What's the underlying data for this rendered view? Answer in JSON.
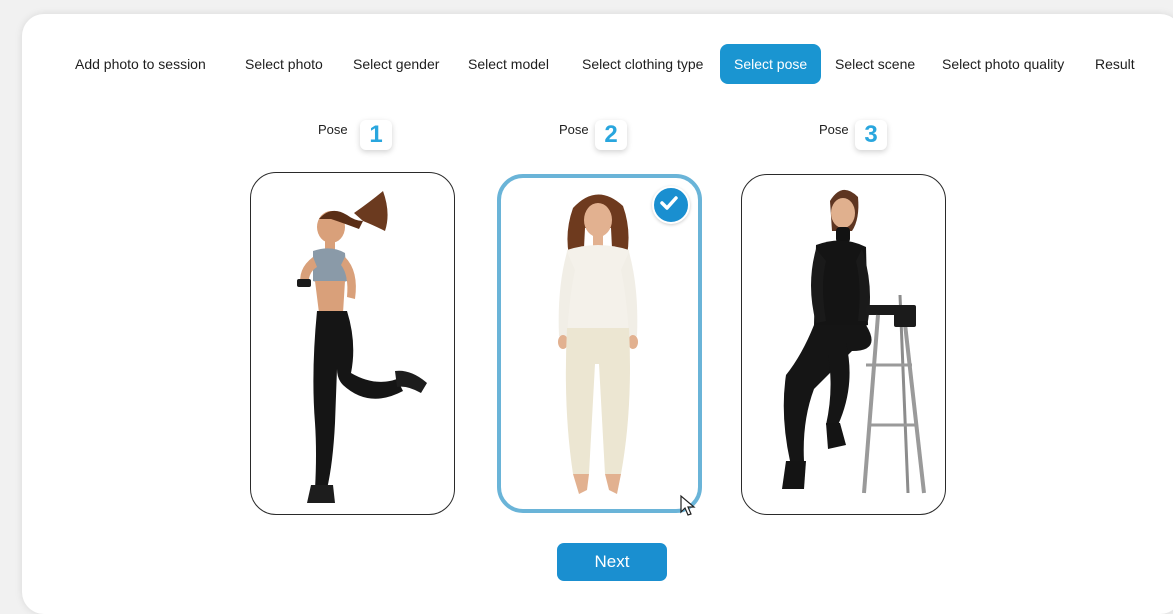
{
  "stepper": {
    "steps": [
      {
        "label": "Add photo to session",
        "active": false
      },
      {
        "label": "Select photo",
        "active": false
      },
      {
        "label": "Select gender",
        "active": false
      },
      {
        "label": "Select model",
        "active": false
      },
      {
        "label": "Select clothing type",
        "active": false
      },
      {
        "label": "Select pose",
        "active": true
      },
      {
        "label": "Select scene",
        "active": false
      },
      {
        "label": "Select photo quality",
        "active": false
      },
      {
        "label": "Result",
        "active": false
      }
    ]
  },
  "poses": [
    {
      "label": "Pose",
      "number": "1",
      "image": "woman-jumping-photo",
      "selected": false
    },
    {
      "label": "Pose",
      "number": "2",
      "image": "woman-standing-photo",
      "selected": true
    },
    {
      "label": "Pose",
      "number": "3",
      "image": "woman-sitting-on-stool-photo",
      "selected": false
    }
  ],
  "actions": {
    "next_label": "Next"
  },
  "colors": {
    "accent": "#1a95d1",
    "selected_border": "#6ab4d8",
    "number": "#29a6de"
  },
  "icons": {
    "selected_indicator": "check-circle-icon",
    "pointer": "mouse-cursor-icon"
  }
}
